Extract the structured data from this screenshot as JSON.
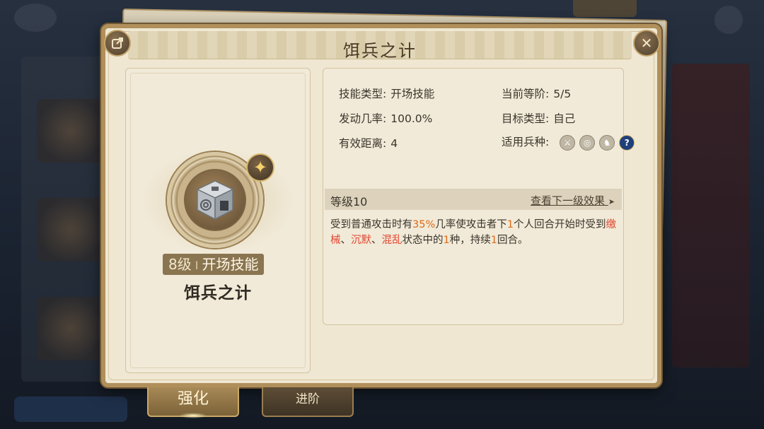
{
  "dialog": {
    "title": "饵兵之计",
    "share_icon": "share-icon",
    "close_icon": "close-icon",
    "close_glyph": "✕"
  },
  "skill_card": {
    "level_text": "8级",
    "separator": "I",
    "type_text": "开场技能",
    "name": "饵兵之计",
    "icon": "dice-skill-icon",
    "badge_icon": "star-badge-icon"
  },
  "info": {
    "skill_type_key": "技能类型:",
    "skill_type_val": "开场技能",
    "current_rank_key": "当前等阶:",
    "current_rank_val": "5/5",
    "trigger_rate_key": "发动几率:",
    "trigger_rate_val": "100.0%",
    "target_type_key": "目标类型:",
    "target_type_val": "自己",
    "range_key": "有效距离:",
    "range_val": "4",
    "troop_key": "适用兵种:",
    "troops": [
      "sword-icon",
      "bow-target-icon",
      "cavalry-icon",
      "question-icon"
    ],
    "troop_q_glyph": "?"
  },
  "level_section": {
    "level_label": "等级10",
    "next_link": "查看下一级效果",
    "next_arrow": "➤"
  },
  "description": {
    "p1": "受到普通攻击时有",
    "v1": "35%",
    "p2": "几率使攻击者下",
    "v2": "1",
    "p3": "个人回合开始时受到",
    "s1": "缴械",
    "sep1": "、",
    "s2": "沉默",
    "sep2": "、",
    "s3": "混乱",
    "p4": "状态中的",
    "v3": "1",
    "p5": "种，持续",
    "v4": "1",
    "p6": "回合。"
  },
  "tabs": {
    "strengthen": "强化",
    "advance": "进阶"
  },
  "colors": {
    "highlight_orange": "#e06a17",
    "highlight_red": "#e2452f",
    "panel_border": "#b08f5b"
  }
}
